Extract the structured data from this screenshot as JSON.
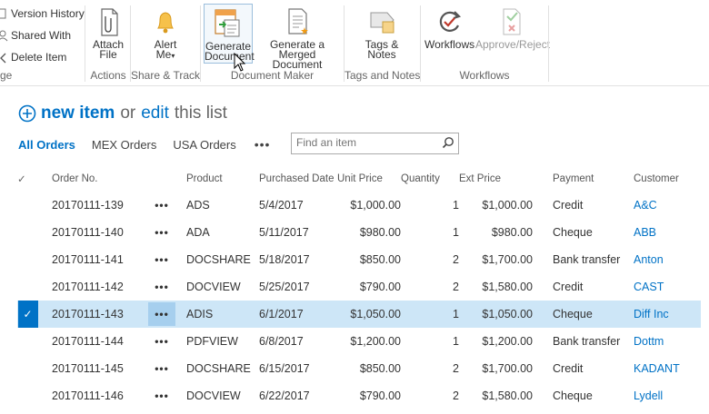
{
  "ribbon": {
    "manage": {
      "items": [
        "Version History",
        "Shared With",
        "Delete Item"
      ],
      "label": "ge"
    },
    "actions": {
      "attach_file": "Attach File",
      "label": "Actions"
    },
    "share_track": {
      "alert_me": "Alert Me",
      "label": "Share & Track"
    },
    "document_maker": {
      "generate_document": "Generate Document",
      "generate_merged": "Generate a Merged Document",
      "label": "Document Maker"
    },
    "tags_notes": {
      "tags_notes": "Tags & Notes",
      "label": "Tags and Notes"
    },
    "workflows": {
      "workflows": "Workflows",
      "approve_reject": "Approve/Reject",
      "label": "Workflows"
    }
  },
  "list": {
    "new_item": "new item",
    "or": "or",
    "edit": "edit",
    "this_list": "this list",
    "views": [
      "All Orders",
      "MEX Orders",
      "USA Orders"
    ],
    "more": "•••",
    "search_placeholder": "Find an item"
  },
  "table": {
    "check_header": "✓",
    "headers": [
      "Order No.",
      "Product",
      "Purchased Date",
      "Unit Price",
      "Quantity",
      "Ext Price",
      "Payment",
      "Customer"
    ],
    "rows": [
      {
        "order": "20170111-139",
        "product": "ADS",
        "date": "5/4/2017",
        "unit": "$1,000.00",
        "qty": "1",
        "ext": "$1,000.00",
        "payment": "Credit",
        "customer": "A&C",
        "selected": false
      },
      {
        "order": "20170111-140",
        "product": "ADA",
        "date": "5/11/2017",
        "unit": "$980.00",
        "qty": "1",
        "ext": "$980.00",
        "payment": "Cheque",
        "customer": "ABB",
        "selected": false
      },
      {
        "order": "20170111-141",
        "product": "DOCSHARE",
        "date": "5/18/2017",
        "unit": "$850.00",
        "qty": "2",
        "ext": "$1,700.00",
        "payment": "Bank transfer",
        "customer": "Anton",
        "selected": false
      },
      {
        "order": "20170111-142",
        "product": "DOCVIEW",
        "date": "5/25/2017",
        "unit": "$790.00",
        "qty": "2",
        "ext": "$1,580.00",
        "payment": "Credit",
        "customer": "CAST",
        "selected": false
      },
      {
        "order": "20170111-143",
        "product": "ADIS",
        "date": "6/1/2017",
        "unit": "$1,050.00",
        "qty": "1",
        "ext": "$1,050.00",
        "payment": "Cheque",
        "customer": "Diff Inc",
        "selected": true
      },
      {
        "order": "20170111-144",
        "product": "PDFVIEW",
        "date": "6/8/2017",
        "unit": "$1,200.00",
        "qty": "1",
        "ext": "$1,200.00",
        "payment": "Bank transfer",
        "customer": "Dottm",
        "selected": false
      },
      {
        "order": "20170111-145",
        "product": "DOCSHARE",
        "date": "6/15/2017",
        "unit": "$850.00",
        "qty": "2",
        "ext": "$1,700.00",
        "payment": "Credit",
        "customer": "KADANT",
        "selected": false
      },
      {
        "order": "20170111-146",
        "product": "DOCVIEW",
        "date": "6/22/2017",
        "unit": "$790.00",
        "qty": "2",
        "ext": "$1,580.00",
        "payment": "Cheque",
        "customer": "Lydell",
        "selected": false
      }
    ],
    "row_menu": "•••",
    "selected_check": "✓"
  },
  "colors": {
    "accent": "#0072c6",
    "selected_row": "#cde6f7"
  }
}
